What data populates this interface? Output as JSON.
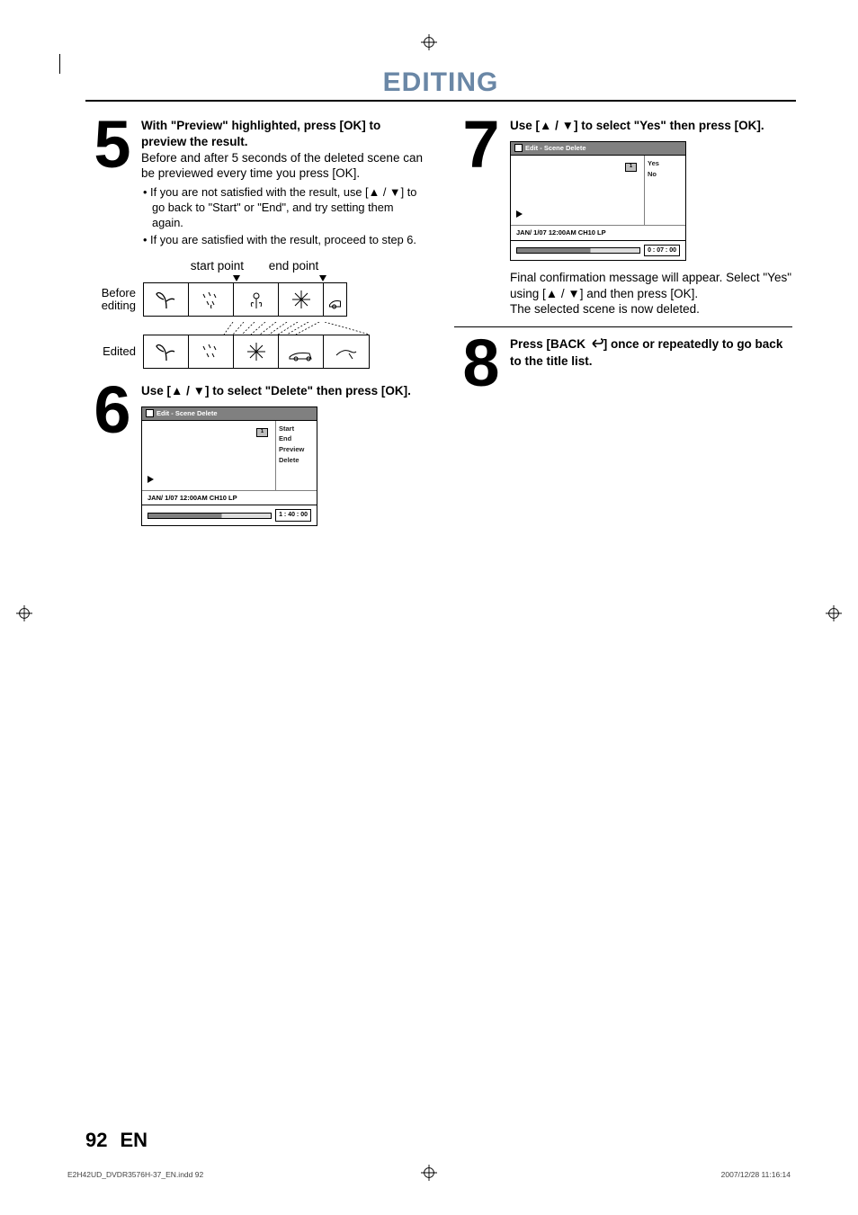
{
  "title": "EDITING",
  "steps": {
    "5": {
      "num": "5",
      "head": "With \"Preview\" highlighted, press [OK] to preview the result.",
      "body": "Before and after 5 seconds of the deleted scene can be previewed every time you press [OK].",
      "bullet1": "If you are not satisfied with the result, use [▲ / ▼] to go back to \"Start\" or \"End\", and try setting them again.",
      "bullet2": "If you are satisfied with the result, proceed to step 6."
    },
    "6": {
      "num": "6",
      "head": "Use [▲ / ▼] to select \"Delete\" then press [OK]."
    },
    "7": {
      "num": "7",
      "head": "Use [▲ / ▼] to select \"Yes\" then press [OK].",
      "after1": "Final confirmation message will appear. Select \"Yes\" using [▲ / ▼] and then press [OK].",
      "after2": "The selected scene is now deleted."
    },
    "8": {
      "num": "8",
      "head_a": "Press [BACK ",
      "head_b": "] once or repeatedly to go back to the title list."
    }
  },
  "diagram": {
    "start_label": "start point",
    "end_label": "end point",
    "before_label": "Before editing",
    "edited_label": "Edited"
  },
  "ui6": {
    "title": "Edit - Scene Delete",
    "thumb": "1",
    "opts": {
      "a": "Start",
      "b": "End",
      "c": "Preview",
      "d": "Delete"
    },
    "info": "JAN/ 1/07 12:00AM CH10   LP",
    "time": "1 : 40 : 00"
  },
  "ui7": {
    "title": "Edit - Scene Delete",
    "thumb": "1",
    "opts": {
      "a": "Yes",
      "b": "No"
    },
    "info": "JAN/ 1/07 12:00AM CH10   LP",
    "time": "0 : 07 : 00"
  },
  "page_num": "92",
  "page_lang": "EN",
  "footer_left": "E2H42UD_DVDR3576H-37_EN.indd   92",
  "footer_right": "2007/12/28   11:16:14"
}
